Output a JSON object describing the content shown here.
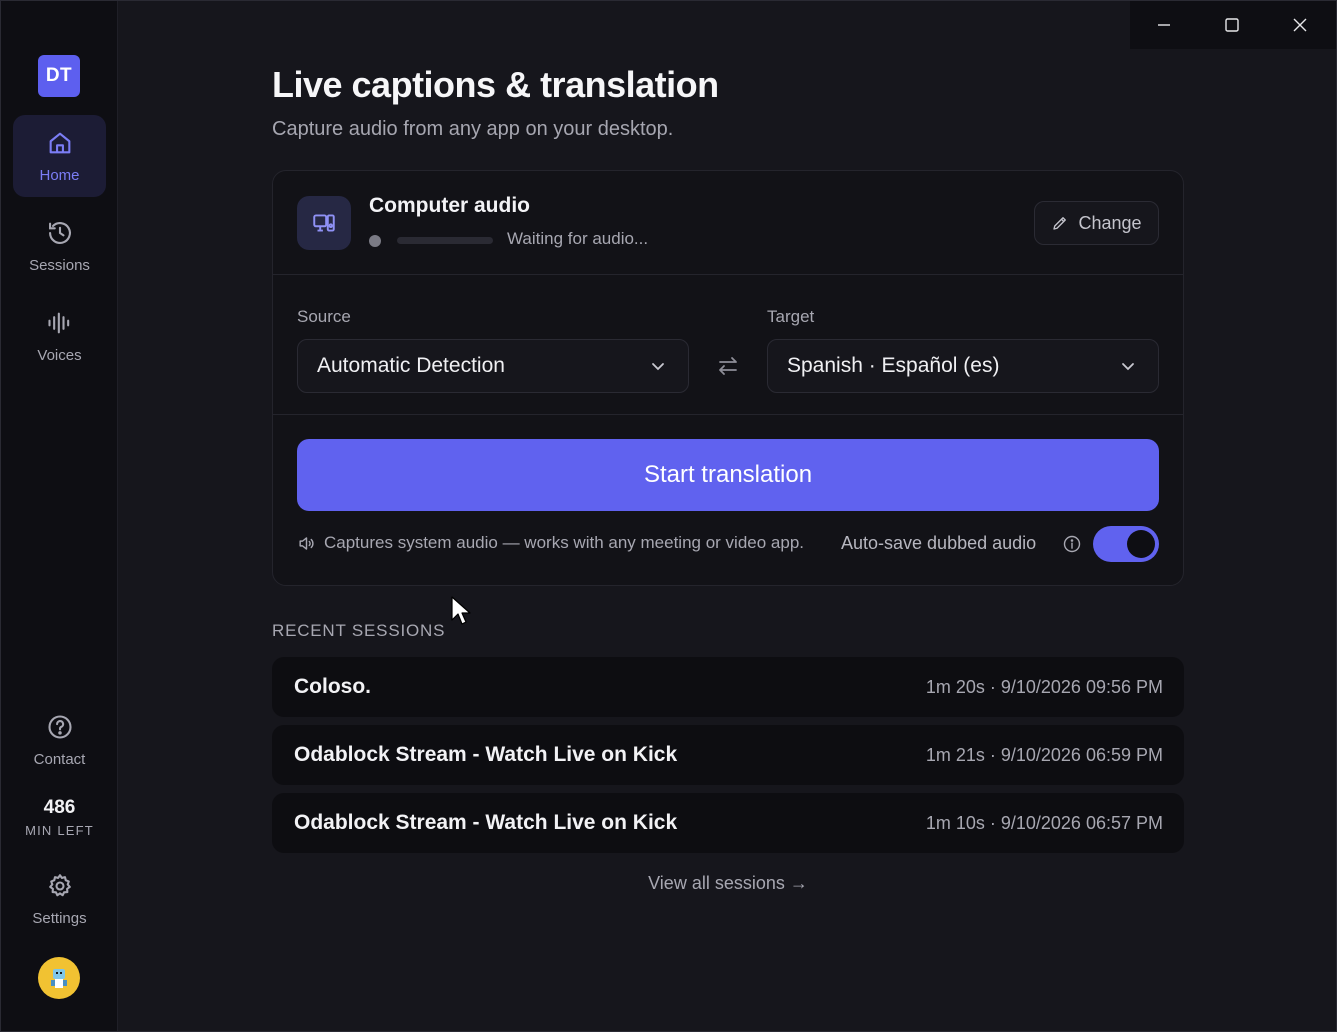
{
  "sidebar": {
    "logo": "DT",
    "items": [
      {
        "label": "Home",
        "icon": "home-icon"
      },
      {
        "label": "Sessions",
        "icon": "history-icon"
      },
      {
        "label": "Voices",
        "icon": "waveform-icon"
      },
      {
        "label": "Contact",
        "icon": "help-circle-icon"
      },
      {
        "label": "Settings",
        "icon": "gear-icon"
      }
    ],
    "minutes_left": {
      "value": "486",
      "label": "MIN LEFT"
    }
  },
  "header": {
    "title": "Live captions & translation",
    "subtitle": "Capture audio from any app on your desktop."
  },
  "source_card": {
    "name": "Computer audio",
    "status": "Waiting for audio...",
    "change_label": "Change"
  },
  "languages": {
    "source_label": "Source",
    "source_value": "Automatic Detection",
    "target_label": "Target",
    "target_value": "Spanish · Español (es)"
  },
  "actions": {
    "start_label": "Start translation",
    "hint": "Captures system audio — works with any meeting or video app.",
    "autosave_label": "Auto-save dubbed audio",
    "autosave_on": true
  },
  "recent": {
    "heading": "RECENT SESSIONS",
    "sessions": [
      {
        "name": "Coloso.",
        "meta": "1m 20s · 9/10/2026 09:56 PM"
      },
      {
        "name": "Odablock Stream - Watch Live on Kick",
        "meta": "1m 21s · 9/10/2026 06:59 PM"
      },
      {
        "name": "Odablock Stream - Watch Live on Kick",
        "meta": "1m 10s · 9/10/2026 06:57 PM"
      }
    ],
    "view_all": "View all sessions →"
  },
  "colors": {
    "accent": "#6062ef",
    "active_nav_bg": "#1c1c35",
    "background": "#16161c"
  }
}
